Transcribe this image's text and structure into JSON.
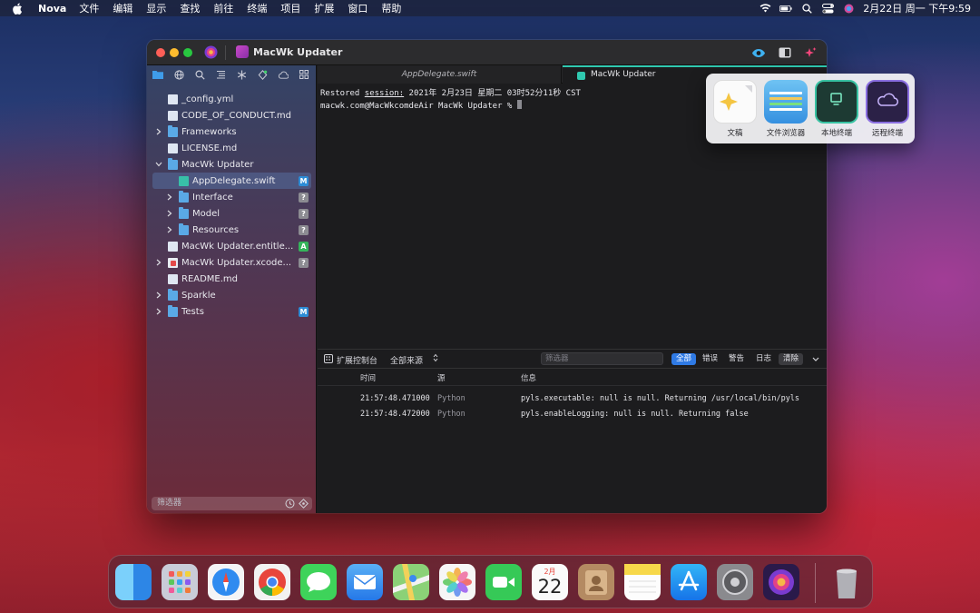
{
  "menubar": {
    "app_name": "Nova",
    "items": [
      "文件",
      "编辑",
      "显示",
      "查找",
      "前往",
      "终端",
      "项目",
      "扩展",
      "窗口",
      "帮助"
    ],
    "clock": "2月22日 周一 下午9:59"
  },
  "window": {
    "project_title": "MacWk Updater"
  },
  "sidebar": {
    "items": [
      {
        "label": "_config.yml",
        "type": "file",
        "expandable": false,
        "depth": 0
      },
      {
        "label": "CODE_OF_CONDUCT.md",
        "type": "file",
        "expandable": false,
        "depth": 0
      },
      {
        "label": "Frameworks",
        "type": "folder",
        "expandable": true,
        "depth": 0
      },
      {
        "label": "LICENSE.md",
        "type": "file",
        "expandable": false,
        "depth": 0
      },
      {
        "label": "MacWk Updater",
        "type": "folder",
        "expandable": true,
        "expanded": true,
        "depth": 0
      },
      {
        "label": "AppDelegate.swift",
        "type": "swift",
        "expandable": false,
        "depth": 1,
        "badge": "M",
        "selected": true
      },
      {
        "label": "Interface",
        "type": "folder",
        "expandable": true,
        "depth": 1,
        "badge": "?"
      },
      {
        "label": "Model",
        "type": "folder",
        "expandable": true,
        "depth": 1,
        "badge": "?"
      },
      {
        "label": "Resources",
        "type": "folder",
        "expandable": true,
        "depth": 1,
        "badge": "?"
      },
      {
        "label": "MacWk Updater.entitle...",
        "type": "file",
        "expandable": false,
        "depth": 0,
        "badge": "A"
      },
      {
        "label": "MacWk Updater.xcode...",
        "type": "xcode",
        "expandable": true,
        "depth": 0,
        "badge": "?"
      },
      {
        "label": "README.md",
        "type": "file",
        "expandable": false,
        "depth": 0
      },
      {
        "label": "Sparkle",
        "type": "folder",
        "expandable": true,
        "depth": 0
      },
      {
        "label": "Tests",
        "type": "folder",
        "expandable": true,
        "depth": 0,
        "badge": "M"
      }
    ],
    "filter_placeholder": "筛选器"
  },
  "tabs": [
    {
      "label": "AppDelegate.swift",
      "active": false
    },
    {
      "label": "MacWk Updater",
      "active": true
    }
  ],
  "terminal": {
    "line1_prefix": "Restored ",
    "line1_session": "session:",
    "line1_rest": " 2021年 2月23日 星期二 03时52分11秒 CST",
    "prompt": "macwk.com@MacWkcomdeAir MacWk Updater % "
  },
  "console": {
    "title": "扩展控制台",
    "source_select": "全部来源",
    "filter_placeholder": "筛选器",
    "segments": [
      "全部",
      "错误",
      "警告",
      "日志"
    ],
    "clear_label": "清除",
    "columns": [
      "时间",
      "源",
      "信息"
    ],
    "rows": [
      {
        "time": "21:57:48.471000",
        "source": "Python",
        "message": "pyls.executable: null is null. Returning /usr/local/bin/pyls"
      },
      {
        "time": "21:57:48.472000",
        "source": "Python",
        "message": "pyls.enableLogging: null is null. Returning false"
      }
    ]
  },
  "popover": {
    "items": [
      {
        "label": "文稿",
        "color": "#fbfbfb"
      },
      {
        "label": "文件浏览器",
        "color": "#4aa8e8"
      },
      {
        "label": "本地终端",
        "color": "#1f5a4c"
      },
      {
        "label": "远程终端",
        "color": "#5b3fa8"
      }
    ]
  },
  "dock": {
    "apps": [
      {
        "name": "finder",
        "color": "#3ba0f0"
      },
      {
        "name": "launchpad",
        "color": "#c4c8d6"
      },
      {
        "name": "safari",
        "color": "#2f8bf0"
      },
      {
        "name": "chrome",
        "color": "#f2f2f2"
      },
      {
        "name": "messages",
        "color": "#3ed35a"
      },
      {
        "name": "mail",
        "color": "#3392f2"
      },
      {
        "name": "maps",
        "color": "#7ec96a"
      },
      {
        "name": "photos",
        "color": "#f6f6f6"
      },
      {
        "name": "facetime",
        "color": "#36c957"
      },
      {
        "name": "calendar",
        "color": "#fafafa"
      },
      {
        "name": "contacts",
        "color": "#b48a62"
      },
      {
        "name": "notes",
        "color": "#f7d84a"
      },
      {
        "name": "app-store",
        "color": "#1e8cf2"
      },
      {
        "name": "system-preferences",
        "color": "#8a8a8e"
      },
      {
        "name": "nova",
        "color": "#6a2ea8"
      },
      {
        "name": "trash",
        "color": "#9a9aa0"
      }
    ],
    "calendar_month": "2月",
    "calendar_day": "22"
  }
}
